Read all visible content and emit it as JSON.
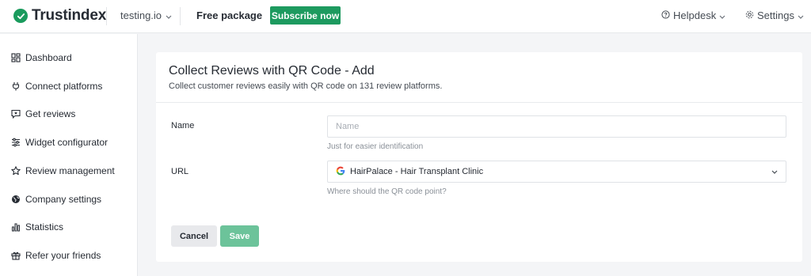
{
  "brand": {
    "name": "Trustindex",
    "accent": "#1d9a5f"
  },
  "header": {
    "site": "testing.io",
    "plan": "Free package",
    "subscribe_label": "Subscribe now",
    "helpdesk_label": "Helpdesk",
    "settings_label": "Settings"
  },
  "sidebar": {
    "items": [
      {
        "label": "Dashboard",
        "icon": "dashboard-icon"
      },
      {
        "label": "Connect platforms",
        "icon": "plug-icon"
      },
      {
        "label": "Get reviews",
        "icon": "review-bubble-icon"
      },
      {
        "label": "Widget configurator",
        "icon": "sliders-icon"
      },
      {
        "label": "Review management",
        "icon": "star-icon"
      },
      {
        "label": "Company settings",
        "icon": "globe-icon"
      },
      {
        "label": "Statistics",
        "icon": "bar-chart-icon"
      },
      {
        "label": "Refer your friends",
        "icon": "gift-icon"
      }
    ]
  },
  "page": {
    "title": "Collect Reviews with QR Code - Add",
    "subtitle": "Collect customer reviews easily with QR code on 131 review platforms."
  },
  "form": {
    "name": {
      "label": "Name",
      "placeholder": "Name",
      "value": "",
      "hint": "Just for easier identification"
    },
    "url": {
      "label": "URL",
      "value": "HairPalace - Hair Transplant Clinic",
      "icon": "google-icon",
      "hint": "Where should the QR code point?"
    },
    "cancel_label": "Cancel",
    "save_label": "Save"
  }
}
